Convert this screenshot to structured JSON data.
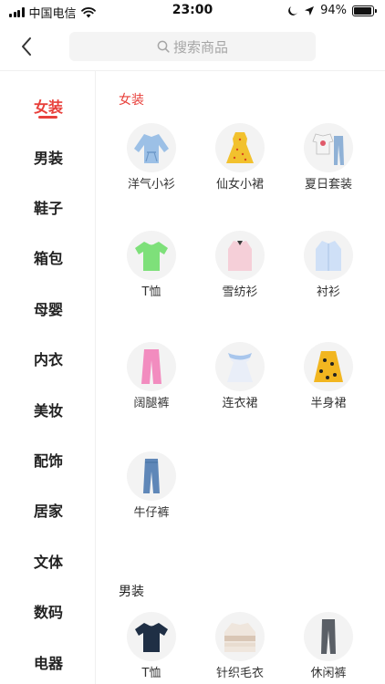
{
  "status_bar": {
    "carrier": "中国电信",
    "time": "23:00",
    "battery": "94%",
    "battery_level": 0.94
  },
  "header": {
    "back_icon": "chevron-left-icon",
    "search_placeholder": "搜索商品",
    "search_icon": "search-icon"
  },
  "sidebar": {
    "active_color": "#e8403b",
    "items": [
      {
        "label": "女装"
      },
      {
        "label": "男装"
      },
      {
        "label": "鞋子"
      },
      {
        "label": "箱包"
      },
      {
        "label": "母婴"
      },
      {
        "label": "内衣"
      },
      {
        "label": "美妆"
      },
      {
        "label": "配饰"
      },
      {
        "label": "居家"
      },
      {
        "label": "文体"
      },
      {
        "label": "数码"
      },
      {
        "label": "电器"
      }
    ]
  },
  "content": {
    "sections": [
      {
        "title": "女装",
        "items": [
          {
            "label": "洋气小衫"
          },
          {
            "label": "仙女小裙"
          },
          {
            "label": "夏日套装"
          },
          {
            "label": "T恤"
          },
          {
            "label": "雪纺衫"
          },
          {
            "label": "衬衫"
          },
          {
            "label": "阔腿裤"
          },
          {
            "label": "连衣裙"
          },
          {
            "label": "半身裙"
          },
          {
            "label": "牛仔裤"
          }
        ]
      },
      {
        "title": "男装",
        "items": [
          {
            "label": "T恤"
          },
          {
            "label": "针织毛衣"
          },
          {
            "label": "休闲裤"
          }
        ]
      }
    ]
  }
}
